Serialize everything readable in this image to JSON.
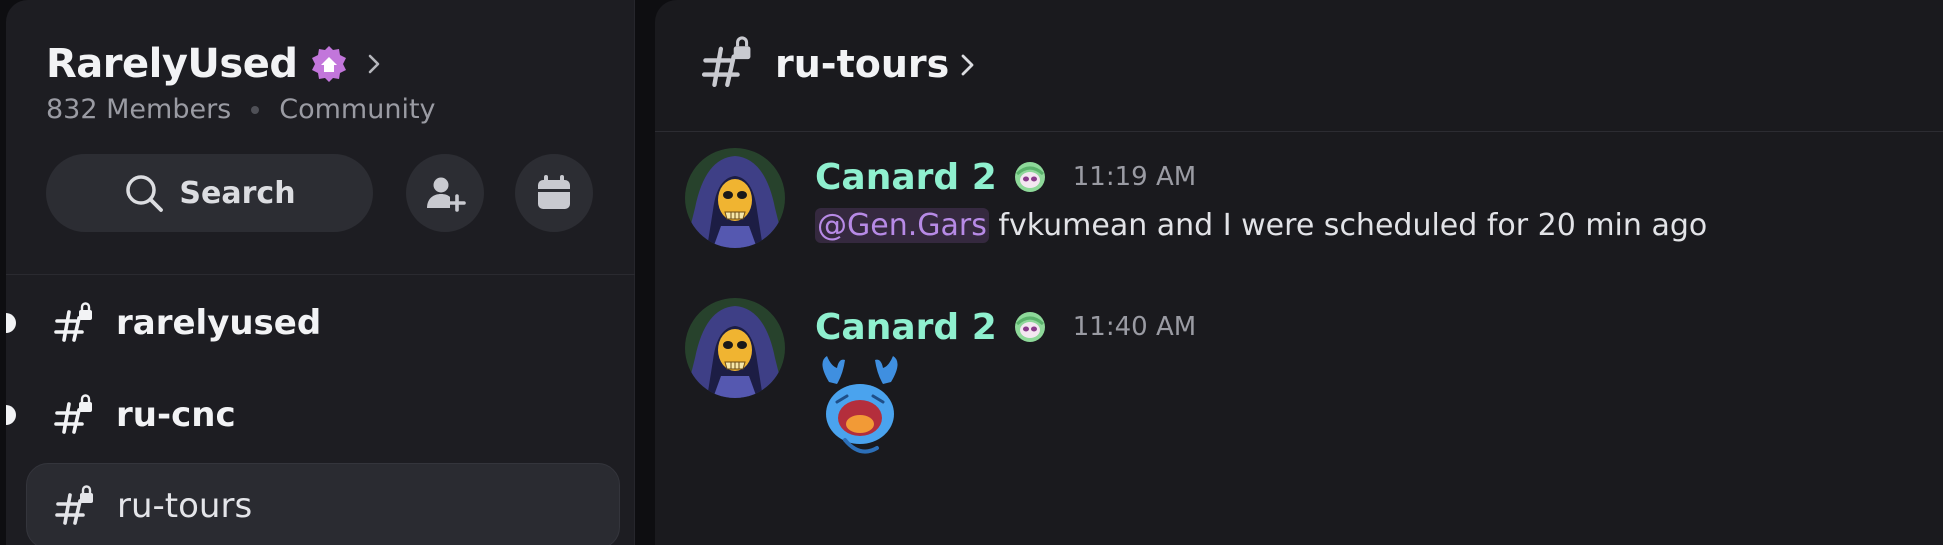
{
  "server": {
    "name": "RarelyUsed",
    "members": "832 Members",
    "type": "Community",
    "search_label": "Search",
    "badge_icon": "home-badge-icon"
  },
  "channels": [
    {
      "name": "rarelyused",
      "unread": true,
      "active": false
    },
    {
      "name": "ru-cnc",
      "unread": true,
      "active": false
    },
    {
      "name": "ru-tours",
      "unread": false,
      "active": true
    }
  ],
  "main": {
    "channel_title": "ru-tours",
    "messages": [
      {
        "author": "Canard 2",
        "time": "11:19 AM",
        "mention": "@Gen.Gars",
        "text": " fvkumean and I were scheduled for 20 min ago"
      },
      {
        "author": "Canard 2",
        "time": "11:40 AM",
        "sticker": "crying-crab-emoji"
      }
    ]
  },
  "colors": {
    "author": "#8ff0cf",
    "mention_text": "#b78ae6",
    "mention_bg": "#35293f",
    "sidebar_bg": "#1d1d22",
    "main_bg": "#1a1a1e"
  }
}
